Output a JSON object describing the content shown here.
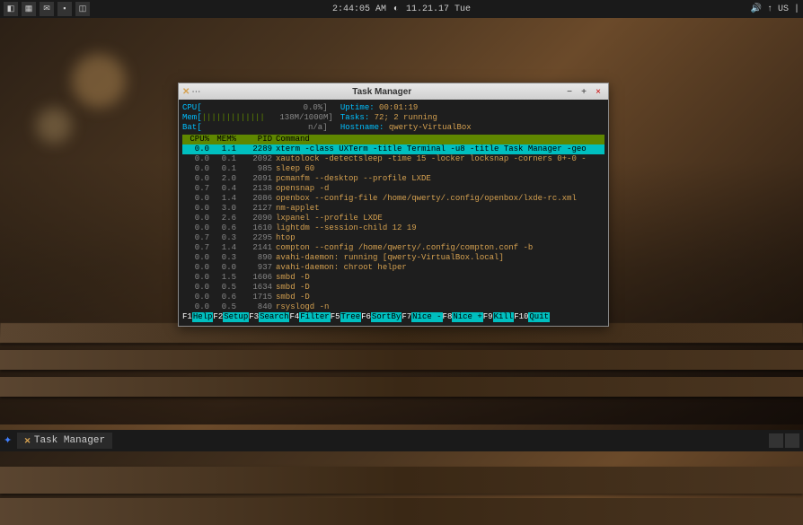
{
  "top_panel": {
    "time": "2:44:05 AM",
    "date": "11.21.17 Tue",
    "volume_icon": "🔊",
    "updates_icon": "↑",
    "locale": "US"
  },
  "bottom_panel": {
    "task_label": "Task Manager"
  },
  "window": {
    "title": "Task Manager"
  },
  "system": {
    "cpu_label": "CPU[",
    "cpu_bar": "",
    "cpu_val": "0.0%]",
    "mem_label": "Mem[",
    "mem_bar": "|||||||||||||",
    "mem_val": "138M/1000M]",
    "bat_label": "Bat[",
    "bat_val": "n/a]",
    "uptime_label": "Uptime: ",
    "uptime_val": "00:01:19",
    "tasks_label": "Tasks: ",
    "tasks_val": "72; 2 running",
    "hostname_label": "Hostname: ",
    "hostname_val": "qwerty-VirtualBox"
  },
  "headers": {
    "cpu": "CPU%",
    "mem": "MEM%",
    "pid": "PID",
    "cmd": "Command"
  },
  "processes": [
    {
      "cpu": "0.0",
      "mem": "1.1",
      "pid": "2289",
      "cmd": "xterm -class UXTerm -title Terminal -u8 -title Task Manager -geo",
      "sel": true
    },
    {
      "cpu": "0.0",
      "mem": "0.1",
      "pid": "2092",
      "cmd": "xautolock -detectsleep -time 15 -locker locksnap -corners 0+-0 -"
    },
    {
      "cpu": "0.0",
      "mem": "0.1",
      "pid": "985",
      "cmd": "sleep 60"
    },
    {
      "cpu": "0.0",
      "mem": "2.0",
      "pid": "2091",
      "cmd": "pcmanfm --desktop --profile LXDE"
    },
    {
      "cpu": "0.7",
      "mem": "0.4",
      "pid": "2138",
      "cmd": "opensnap -d"
    },
    {
      "cpu": "0.0",
      "mem": "1.4",
      "pid": "2086",
      "cmd": "openbox --config-file /home/qwerty/.config/openbox/lxde-rc.xml"
    },
    {
      "cpu": "0.0",
      "mem": "3.0",
      "pid": "2127",
      "cmd": "nm-applet"
    },
    {
      "cpu": "0.0",
      "mem": "2.6",
      "pid": "2090",
      "cmd": "lxpanel --profile LXDE"
    },
    {
      "cpu": "0.0",
      "mem": "0.6",
      "pid": "1610",
      "cmd": "lightdm --session-child 12 19"
    },
    {
      "cpu": "0.7",
      "mem": "0.3",
      "pid": "2295",
      "cmd": "htop"
    },
    {
      "cpu": "0.7",
      "mem": "1.4",
      "pid": "2141",
      "cmd": "compton --config /home/qwerty/.config/compton.conf -b"
    },
    {
      "cpu": "0.0",
      "mem": "0.3",
      "pid": "890",
      "cmd": "avahi-daemon: running [qwerty-VirtualBox.local]"
    },
    {
      "cpu": "0.0",
      "mem": "0.0",
      "pid": "937",
      "cmd": "avahi-daemon: chroot helper"
    },
    {
      "cpu": "0.0",
      "mem": "1.5",
      "pid": "1606",
      "cmd": "smbd -D"
    },
    {
      "cpu": "0.0",
      "mem": "0.5",
      "pid": "1634",
      "cmd": "smbd -D"
    },
    {
      "cpu": "0.0",
      "mem": "0.6",
      "pid": "1715",
      "cmd": "smbd -D"
    },
    {
      "cpu": "0.0",
      "mem": "0.5",
      "pid": "840",
      "cmd": "rsyslogd -n"
    }
  ],
  "fkeys": [
    {
      "key": "F1",
      "label": "Help"
    },
    {
      "key": "F2",
      "label": "Setup"
    },
    {
      "key": "F3",
      "label": "Search"
    },
    {
      "key": "F4",
      "label": "Filter"
    },
    {
      "key": "F5",
      "label": "Tree"
    },
    {
      "key": "F6",
      "label": "SortBy"
    },
    {
      "key": "F7",
      "label": "Nice -"
    },
    {
      "key": "F8",
      "label": "Nice +"
    },
    {
      "key": "F9",
      "label": "Kill"
    },
    {
      "key": "F10",
      "label": "Quit"
    }
  ]
}
